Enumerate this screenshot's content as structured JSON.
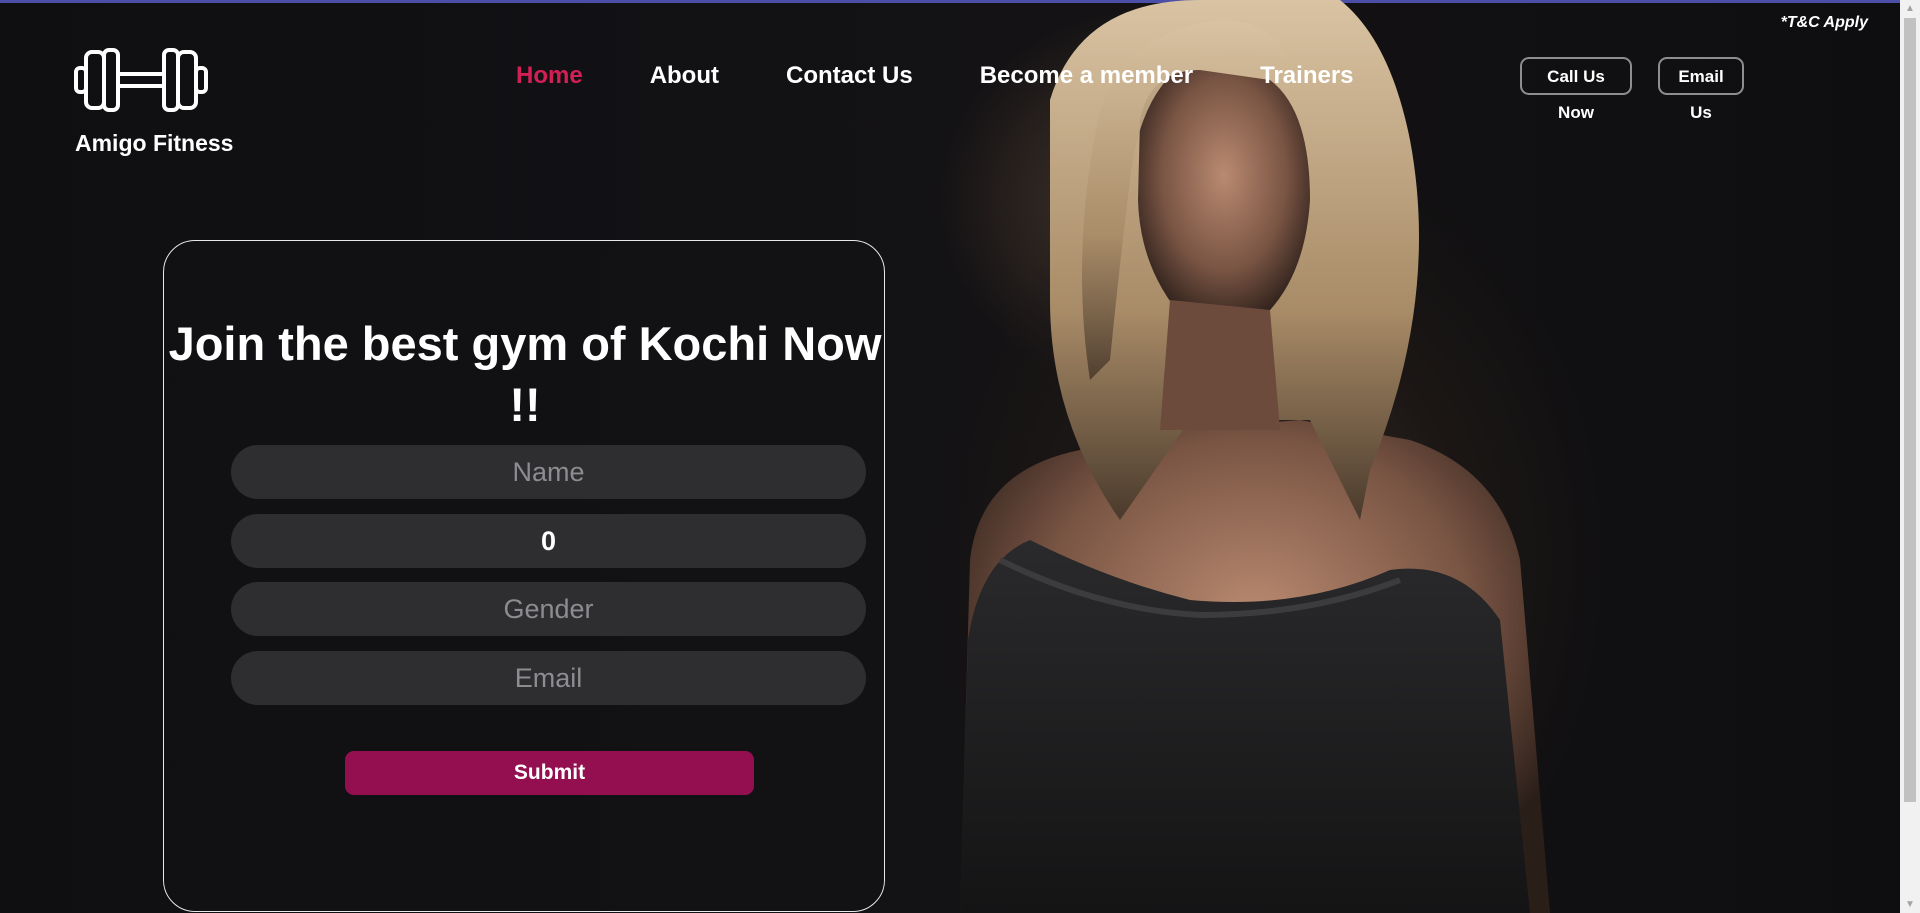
{
  "header": {
    "terms_note": "*T&C Apply",
    "brand_name": "Amigo Fitness",
    "logo_icon": "dumbbell-icon",
    "nav": [
      {
        "label": "Home",
        "active": true
      },
      {
        "label": "About",
        "active": false
      },
      {
        "label": "Contact Us",
        "active": false
      },
      {
        "label": "Become a member",
        "active": false
      },
      {
        "label": "Trainers",
        "active": false
      }
    ],
    "call_button": "Call Us Now",
    "email_button": "Email Us"
  },
  "form": {
    "title": "Join the best gym of Kochi Now !!",
    "name_placeholder": "Name",
    "number_value": "0",
    "gender_placeholder": "Gender",
    "email_placeholder": "Email",
    "submit_label": "Submit"
  },
  "colors": {
    "accent_nav": "#d21f55",
    "submit_bg": "#940f50",
    "field_bg": "#2e2d30",
    "background": "#0d0d0f"
  }
}
